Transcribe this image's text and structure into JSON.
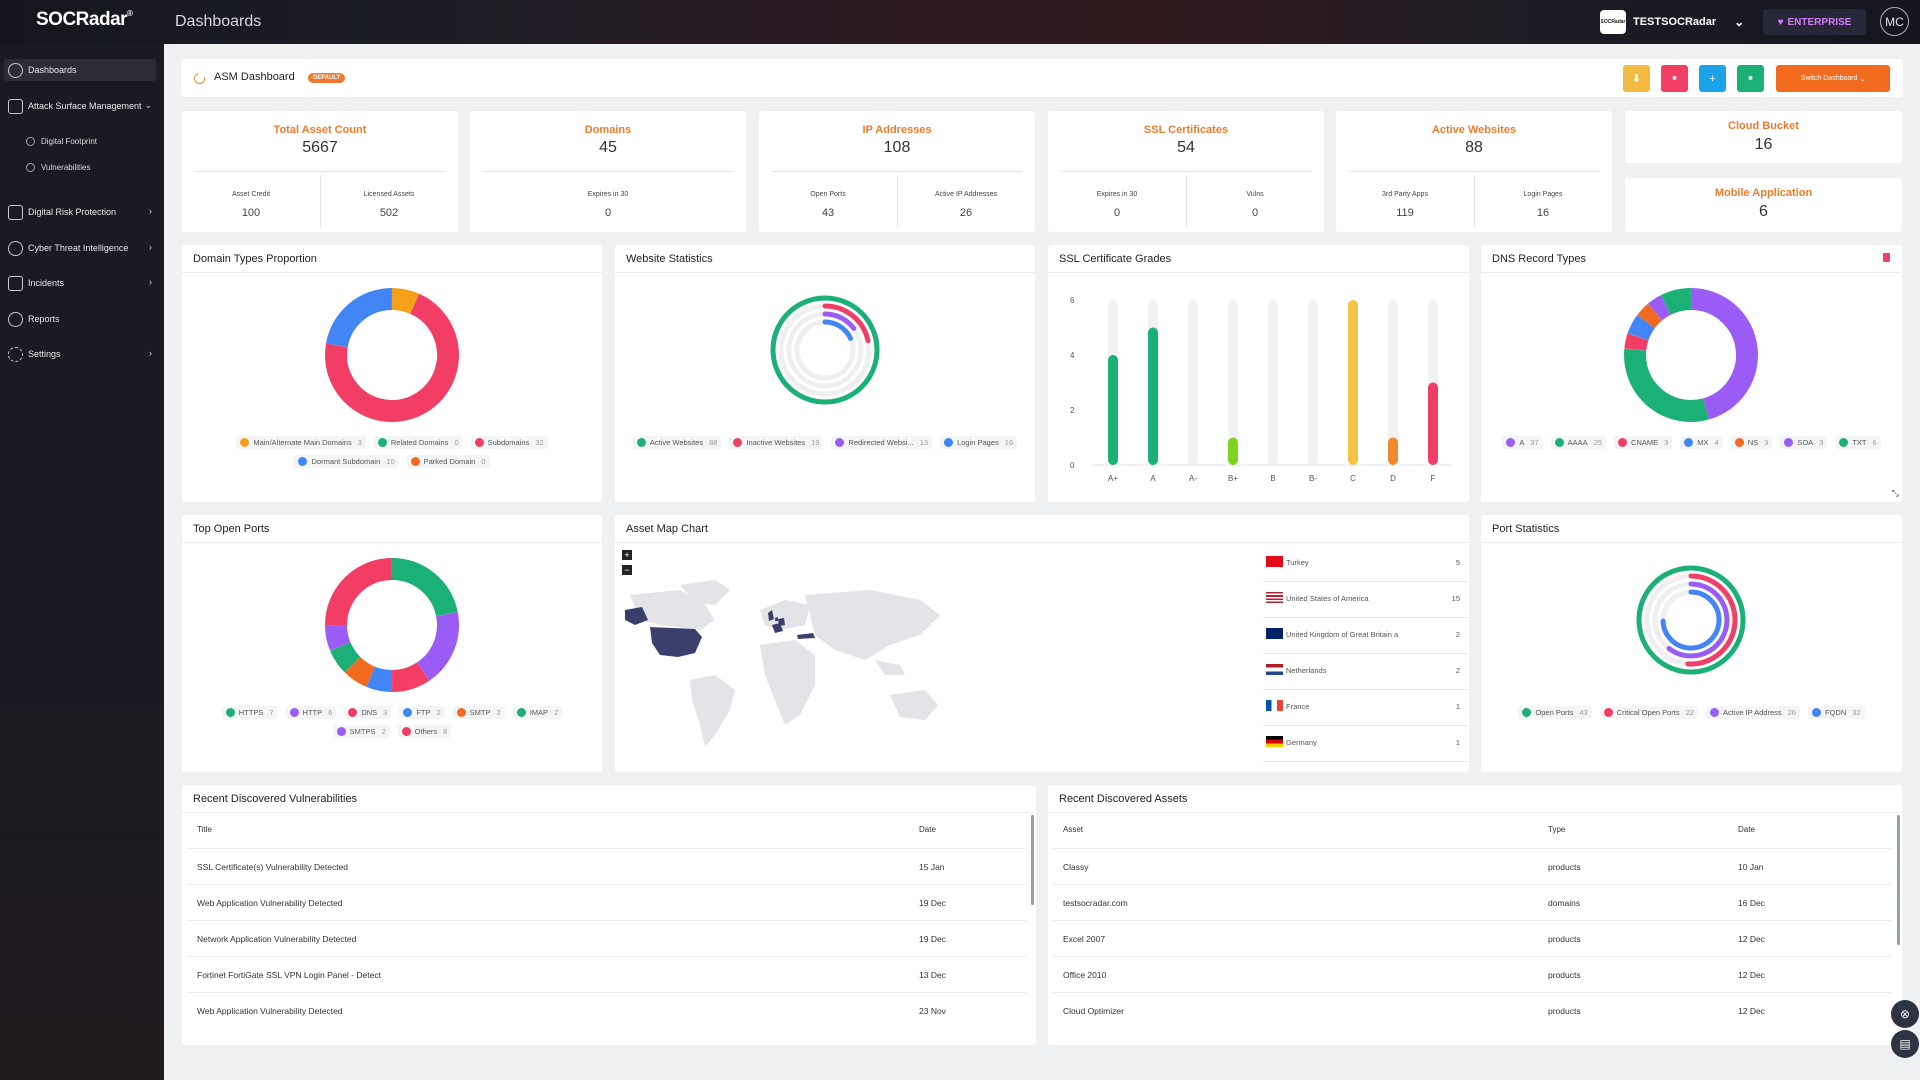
{
  "app": {
    "logo": "SOCRadar",
    "logo_reg": "®",
    "section": "Dashboards"
  },
  "topbar": {
    "org_logo": "SOCRadar",
    "org_name": "TESTSOCRadar",
    "plan": "ENTERPRISE",
    "avatar": "MC"
  },
  "sidebar": {
    "items": [
      {
        "label": "Dashboards",
        "icon": "dashboard-icon"
      },
      {
        "label": "Attack Surface Management",
        "icon": "asm-icon"
      },
      {
        "label": "Digital Risk Protection",
        "icon": "drp-icon"
      },
      {
        "label": "Cyber Threat Intelligence",
        "icon": "cti-icon"
      },
      {
        "label": "Incidents",
        "icon": "incidents-icon"
      },
      {
        "label": "Reports",
        "icon": "reports-icon"
      },
      {
        "label": "Settings",
        "icon": "settings-icon"
      }
    ],
    "sub_items": [
      "Digital Footprint",
      "Vulnerabilities"
    ],
    "collapse": "«"
  },
  "header": {
    "title": "ASM Dashboard",
    "badge": "DEFAULT",
    "switch_label": "Switch Dashboard",
    "buttons": [
      {
        "name": "download-button",
        "glyph": "⬇",
        "color": "#f4b942"
      },
      {
        "name": "delete-button",
        "glyph": "■",
        "color": "#f23d65"
      },
      {
        "name": "add-button",
        "glyph": "+",
        "color": "#1aa3e8"
      },
      {
        "name": "save-button",
        "glyph": "■",
        "color": "#1ab076"
      }
    ]
  },
  "stats": [
    {
      "label": "Total Asset Count",
      "value": "5667",
      "sub": [
        {
          "label": "Asset Credit",
          "value": "100"
        },
        {
          "label": "Licensed Assets",
          "value": "502"
        }
      ]
    },
    {
      "label": "Domains",
      "value": "45",
      "sub": [
        {
          "label": "Expires in 30",
          "value": "0"
        }
      ]
    },
    {
      "label": "IP Addresses",
      "value": "108",
      "sub": [
        {
          "label": "Open Ports",
          "value": "43"
        },
        {
          "label": "Active IP Addresses",
          "value": "26"
        }
      ]
    },
    {
      "label": "SSL Certificates",
      "value": "54",
      "sub": [
        {
          "label": "Expires in 30",
          "value": "0"
        },
        {
          "label": "Vulns",
          "value": "0"
        }
      ]
    },
    {
      "label": "Active Websites",
      "value": "88",
      "sub": [
        {
          "label": "3rd Party Apps",
          "value": "119"
        },
        {
          "label": "Login Pages",
          "value": "16"
        }
      ]
    }
  ],
  "mini_stats": [
    {
      "label": "Cloud Bucket",
      "value": "16"
    },
    {
      "label": "Mobile Application",
      "value": "6"
    }
  ],
  "panels": {
    "domain_types": {
      "title": "Domain Types Proportion"
    },
    "website_stats": {
      "title": "Website Statistics"
    },
    "ssl_grades": {
      "title": "SSL Certificate Grades"
    },
    "dns_types": {
      "title": "DNS Record Types"
    },
    "open_ports": {
      "title": "Top Open Ports"
    },
    "asset_map": {
      "title": "Asset Map Chart",
      "zoom_in": "+",
      "zoom_out": "−"
    },
    "port_stats": {
      "title": "Port Statistics"
    }
  },
  "chart_data": [
    {
      "type": "pie",
      "title": "Domain Types Proportion",
      "donut": true,
      "series": [
        {
          "name": "Main/Alternate Main Domains",
          "value": 3,
          "color": "#f6a01a"
        },
        {
          "name": "Related Domains",
          "value": 0,
          "color": "#1ab076"
        },
        {
          "name": "Subdomains",
          "value": 32,
          "color": "#f23d65"
        },
        {
          "name": "Dormant Subdomain",
          "value": 10,
          "color": "#4285f4"
        },
        {
          "name": "Parked Domain",
          "value": 0,
          "color": "#f16a1d"
        }
      ]
    },
    {
      "type": "radial",
      "title": "Website Statistics",
      "max": 88,
      "series": [
        {
          "name": "Active Websites",
          "value": 88,
          "color": "#1ab076"
        },
        {
          "name": "Inactive Websites",
          "value": 19,
          "color": "#f23d65"
        },
        {
          "name": "Redirected Websi...",
          "value": 13,
          "color": "#9b5cf6"
        },
        {
          "name": "Login Pages",
          "value": 16,
          "color": "#4285f4"
        }
      ]
    },
    {
      "type": "bar",
      "title": "SSL Certificate Grades",
      "categories": [
        "A+",
        "A",
        "A-",
        "B+",
        "B",
        "B-",
        "C",
        "D",
        "F"
      ],
      "values": [
        4,
        5,
        0,
        1,
        0,
        0,
        6,
        1,
        3
      ],
      "colors": [
        "#1ab076",
        "#1ab076",
        "#1ab076",
        "#7ed321",
        "#7ed321",
        "#f4c542",
        "#f4c542",
        "#f08a2c",
        "#f23d65"
      ],
      "yticks": [
        "0",
        "2",
        "4",
        "6"
      ],
      "ylim": [
        0,
        6
      ]
    },
    {
      "type": "pie",
      "title": "DNS Record Types",
      "donut": true,
      "series": [
        {
          "name": "A",
          "value": 37,
          "color": "#9b5cf6"
        },
        {
          "name": "AAAA",
          "value": 25,
          "color": "#1ab076"
        },
        {
          "name": "CNAME",
          "value": 3,
          "color": "#f23d65"
        },
        {
          "name": "MX",
          "value": 4,
          "color": "#4285f4"
        },
        {
          "name": "NS",
          "value": 3,
          "color": "#f16a1d"
        },
        {
          "name": "SOA",
          "value": 3,
          "color": "#9b5cf6"
        },
        {
          "name": "TXT",
          "value": 6,
          "color": "#1ab076"
        }
      ]
    },
    {
      "type": "pie",
      "title": "Top Open Ports",
      "donut": true,
      "series": [
        {
          "name": "HTTPS",
          "value": 7,
          "color": "#1ab076"
        },
        {
          "name": "HTTP",
          "value": 6,
          "color": "#9b5cf6"
        },
        {
          "name": "DNS",
          "value": 3,
          "color": "#f23d65"
        },
        {
          "name": "FTP",
          "value": 2,
          "color": "#4285f4"
        },
        {
          "name": "SMTP",
          "value": 2,
          "color": "#f16a1d"
        },
        {
          "name": "IMAP",
          "value": 2,
          "color": "#1ab076"
        },
        {
          "name": "SMTPS",
          "value": 2,
          "color": "#9b5cf6"
        },
        {
          "name": "Others",
          "value": 8,
          "color": "#f23d65"
        }
      ]
    },
    {
      "type": "radial",
      "title": "Port Statistics",
      "max": 43,
      "series": [
        {
          "name": "Open Ports",
          "value": 43,
          "color": "#1ab076"
        },
        {
          "name": "Critical Open Ports",
          "value": 22,
          "color": "#f23d65"
        },
        {
          "name": "Active IP Address",
          "value": 26,
          "color": "#9b5cf6"
        },
        {
          "name": "FQDN",
          "value": 32,
          "color": "#4285f4"
        }
      ]
    }
  ],
  "countries": [
    {
      "name": "Turkey",
      "count": "5",
      "flag": "tr"
    },
    {
      "name": "United States of America",
      "count": "15",
      "flag": "us"
    },
    {
      "name": "United Kingdom of Great Britain a",
      "count": "2",
      "flag": "gb"
    },
    {
      "name": "Netherlands",
      "count": "2",
      "flag": "nl"
    },
    {
      "name": "France",
      "count": "1",
      "flag": "fr"
    },
    {
      "name": "Germany",
      "count": "1",
      "flag": "de"
    }
  ],
  "vulns": {
    "title": "Recent Discovered Vulnerabilities",
    "headers": [
      "Title",
      "Date"
    ],
    "rows": [
      [
        "SSL Certificate(s) Vulnerability Detected",
        "15 Jan"
      ],
      [
        "Web Application Vulnerability Detected",
        "19 Dec"
      ],
      [
        "Network Application Vulnerability Detected",
        "19 Dec"
      ],
      [
        "Fortinet FortiGate SSL VPN Login Panel - Detect",
        "13 Dec"
      ],
      [
        "Web Application Vulnerability Detected",
        "23 Nov"
      ]
    ]
  },
  "assets": {
    "title": "Recent Discovered Assets",
    "headers": [
      "Asset",
      "Type",
      "Date"
    ],
    "rows": [
      [
        "Classy",
        "products",
        "10 Jan"
      ],
      [
        "testsocradar.com",
        "domains",
        "16 Dec"
      ],
      [
        "Excel 2007",
        "products",
        "12 Dec"
      ],
      [
        "Office 2010",
        "products",
        "12 Dec"
      ],
      [
        "Cloud Optimizer",
        "products",
        "12 Dec"
      ]
    ]
  }
}
